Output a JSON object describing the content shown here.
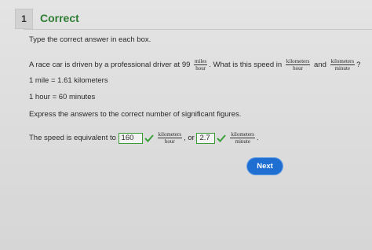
{
  "header": {
    "question_number": "1",
    "status": "Correct"
  },
  "instructions": "Type the correct answer in each box.",
  "problem": {
    "lead": "A race car is driven by a professional driver at 99",
    "unit1_num": "miles",
    "unit1_den": "hour",
    "mid": ". What is this speed in",
    "unit2_num": "kilometers",
    "unit2_den": "hour",
    "and": "and",
    "unit3_num": "kilometers",
    "unit3_den": "minute",
    "end": "?"
  },
  "facts": {
    "mile": "1 mile = 1.61 kilometers",
    "hour": "1 hour = 60 minutes"
  },
  "sigfig_instruction": "Express the answers to the correct number of significant figures.",
  "answer": {
    "lead": "The speed is equivalent to",
    "value1": "160",
    "unit1_num": "kilometers",
    "unit1_den": "hour",
    "or": ", or",
    "value2": "2.7",
    "unit2_num": "kilometers",
    "unit2_den": "minute",
    "end": "."
  },
  "colors": {
    "correct": "#2e7d32",
    "check": "#3aa23a",
    "button": "#1e6fd1"
  },
  "next_button": {
    "label": "Next"
  }
}
